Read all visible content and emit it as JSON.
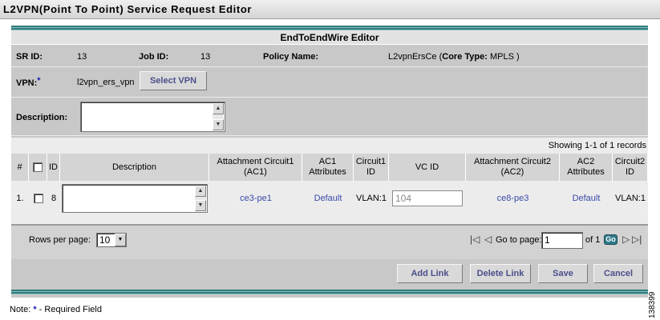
{
  "page_title": "L2VPN(Point To Point) Service Request Editor",
  "editor_title": "EndToEndWire Editor",
  "info": {
    "sr_id_label": "SR ID:",
    "sr_id_value": "13",
    "job_id_label": "Job ID:",
    "job_id_value": "13",
    "policy_name_label": "Policy Name:",
    "policy_name_value": "L2vpnErsCe (",
    "core_type_label": "Core Type:",
    "core_type_value": "MPLS )",
    "vpn_label": "VPN:",
    "required_mark": "*",
    "vpn_value": "l2vpn_ers_vpn",
    "select_vpn_label": "Select VPN",
    "description_label": "Description:"
  },
  "table": {
    "showing_text": "Showing 1-1 of 1 records",
    "headers": {
      "num": "#",
      "id": "ID",
      "description": "Description",
      "ac1": "Attachment Circuit1 (AC1)",
      "ac1_attr": "AC1 Attributes",
      "circuit1_id": "Circuit1 ID",
      "vc_id": "VC ID",
      "ac2": "Attachment Circuit2 (AC2)",
      "ac2_attr": "AC2 Attributes",
      "circuit2_id": "Circuit2 ID"
    },
    "rows": [
      {
        "num": "1.",
        "id": "8",
        "ac1": "ce3-pe1",
        "ac1_attr": "Default",
        "circuit1_id": "VLAN:1",
        "vc_id": "104",
        "ac2": "ce8-pe3",
        "ac2_attr": "Default",
        "circuit2_id": "VLAN:1"
      }
    ]
  },
  "pager": {
    "rows_per_page_label": "Rows per page:",
    "rows_per_page_value": "10",
    "go_to_page_label": "Go to page:",
    "page_value": "1",
    "of_label": "of 1",
    "go_label": "Go"
  },
  "buttons": {
    "add_link": "Add Link",
    "delete_link": "Delete Link",
    "save": "Save",
    "cancel": "Cancel"
  },
  "footer": {
    "note_prefix": "Note:",
    "required_mark": "*",
    "note_text": "- Required Field",
    "figure_id": "138399"
  }
}
